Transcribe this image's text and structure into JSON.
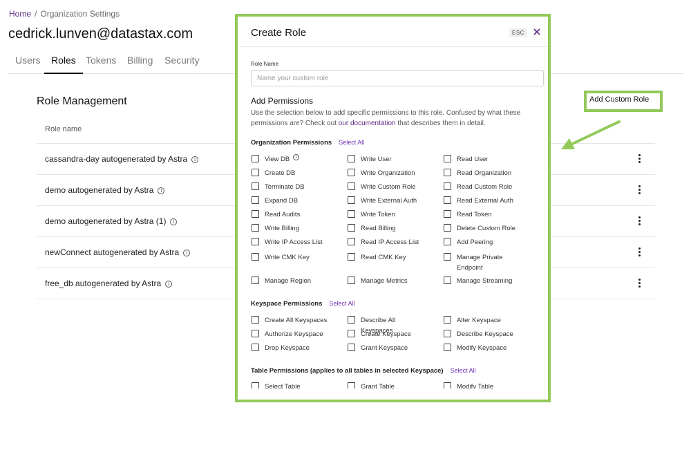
{
  "breadcrumb": {
    "home": "Home",
    "separator": "/",
    "current": "Organization Settings"
  },
  "page": {
    "title": "cedrick.lunven@datastax.com"
  },
  "tabs": [
    {
      "label": "Users"
    },
    {
      "label": "Roles"
    },
    {
      "label": "Tokens"
    },
    {
      "label": "Billing"
    },
    {
      "label": "Security"
    }
  ],
  "active_tab": "Roles",
  "role_management": {
    "heading": "Role Management",
    "column_header": "Role name",
    "add_button": "Add Custom Role",
    "roles": [
      {
        "name": "cassandra-day autogenerated by Astra"
      },
      {
        "name": "demo autogenerated by Astra"
      },
      {
        "name": "demo autogenerated by Astra (1)"
      },
      {
        "name": "newConnect autogenerated by Astra"
      },
      {
        "name": "free_db autogenerated by Astra"
      }
    ]
  },
  "modal": {
    "title": "Create Role",
    "esc_label": "ESC",
    "role_name_label": "Role Name",
    "role_name_placeholder": "Name your custom role",
    "role_name_value": "",
    "add_permissions_title": "Add Permissions",
    "description_before": "Use the selection below to add specific permissions to this role. Confused by what these permissions are? Check out ",
    "description_link": "our documentation",
    "description_after": " that describes them in detail.",
    "select_all": "Select All",
    "org_section": "Organization Permissions",
    "org_permissions": [
      "View DB",
      "Write User",
      "Read User",
      "Create DB",
      "Write Organization",
      "Read Organization",
      "Terminate DB",
      "Write Custom Role",
      "Read Custom Role",
      "Expand DB",
      "Write External Auth",
      "Read External Auth",
      "Read Audits",
      "Write Token",
      "Read Token",
      "Write Billing",
      "Read Billing",
      "Delete Custom Role",
      "Write IP Access List",
      "Read IP Access List",
      "Add Peering",
      "Write CMK Key",
      "Read CMK Key",
      "Manage Private Endpoint",
      "Manage Region",
      "Manage Metrics",
      "Manage Streaming"
    ],
    "keyspace_section": "Keyspace Permissions",
    "keyspace_permissions": [
      "Create All Keyspaces",
      "Describe All Keyspaces",
      "Alter Keyspace",
      "Authorize Keyspace",
      "Create Keyspace",
      "Describe Keyspace",
      "Drop Keyspace",
      "Grant Keyspace",
      "Modify Keyspace"
    ],
    "table_section": "Table Permissions (applies to all tables in selected Keyspace)",
    "table_permissions": [
      "Select Table",
      "Grant Table",
      "Modify Table"
    ]
  },
  "icons": {
    "close": "close-icon",
    "info": "info-icon",
    "menu": "kebab-menu-icon",
    "annotation": "arrow-icon"
  },
  "colors": {
    "accent": "#5b2c83",
    "select_all": "#6e2fb3",
    "highlight": "#93c95a"
  }
}
